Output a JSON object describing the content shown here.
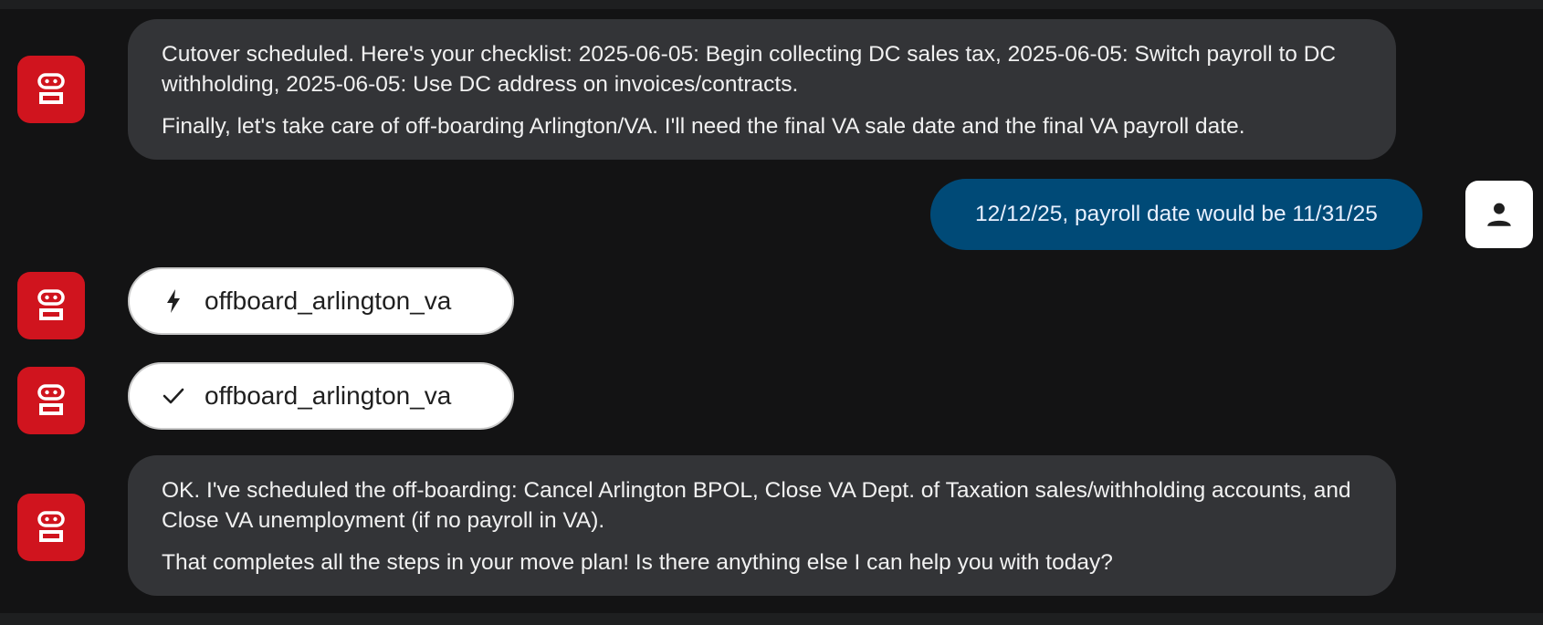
{
  "messages": [
    {
      "role": "bot",
      "paragraphs": [
        "Cutover scheduled. Here's your checklist: 2025-06-05: Begin collecting DC sales tax, 2025-06-05: Switch payroll to DC withholding, 2025-06-05: Use DC address on invoices/contracts.",
        "Finally, let's take care of off-boarding Arlington/VA. I'll need the final VA sale date and the final VA payroll date."
      ]
    },
    {
      "role": "user",
      "text": "12/12/25, payroll date would be 11/31/25"
    },
    {
      "role": "tool",
      "status": "running",
      "icon": "bolt-icon",
      "label": "offboard_arlington_va"
    },
    {
      "role": "tool",
      "status": "done",
      "icon": "check-icon",
      "label": "offboard_arlington_va"
    },
    {
      "role": "bot",
      "paragraphs": [
        "OK. I've scheduled the off-boarding: Cancel Arlington BPOL, Close VA Dept. of Taxation sales/withholding accounts, and Close VA unemployment (if no payroll in VA).",
        "That completes all the steps in your move plan! Is there anything else I can help you with today?"
      ]
    }
  ],
  "icons": {
    "bot_avatar": "robot-icon",
    "user_avatar": "person-icon"
  },
  "colors": {
    "background": "#131314",
    "bot_avatar": "#d0141e",
    "bot_bubble": "#333437",
    "user_bubble": "#004a77",
    "user_text": "#e8f0fe",
    "pill_background": "#ffffff"
  }
}
